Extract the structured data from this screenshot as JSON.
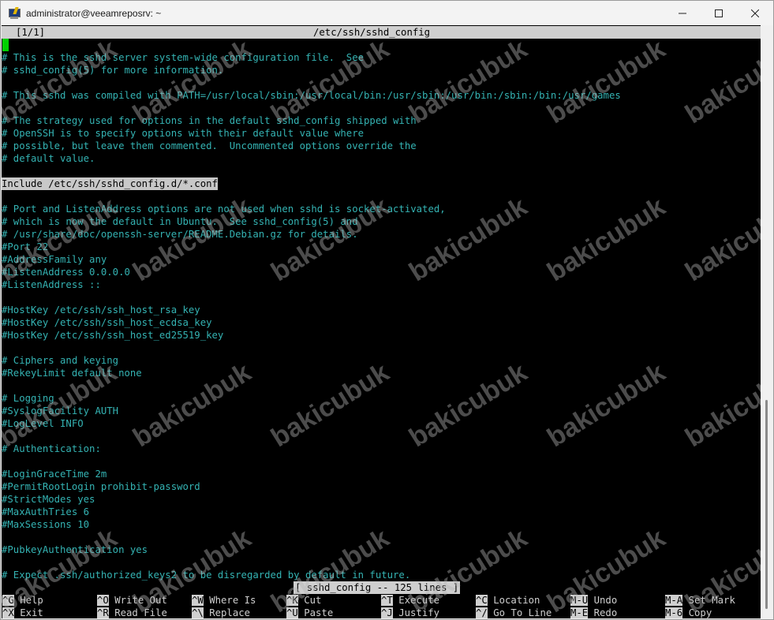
{
  "window": {
    "title": "administrator@veeamreposrv: ~",
    "icon": "putty-terminal-icon",
    "controls": [
      "minimize-icon",
      "maximize-icon",
      "close-icon"
    ]
  },
  "editor": {
    "position": "[1/1]",
    "filename": "/etc/ssh/sshd_config",
    "lines": [
      {
        "text": "# This is the sshd server system-wide configuration file.  See",
        "style": "comment"
      },
      {
        "text": "# sshd_config(5) for more information.",
        "style": "comment"
      },
      {
        "text": "",
        "style": "comment"
      },
      {
        "text": "# This sshd was compiled with PATH=/usr/local/sbin:/usr/local/bin:/usr/sbin:/usr/bin:/sbin:/bin:/usr/games",
        "style": "comment"
      },
      {
        "text": "",
        "style": "comment"
      },
      {
        "text": "# The strategy used for options in the default sshd_config shipped with",
        "style": "comment"
      },
      {
        "text": "# OpenSSH is to specify options with their default value where",
        "style": "comment"
      },
      {
        "text": "# possible, but leave them commented.  Uncommented options override the",
        "style": "comment"
      },
      {
        "text": "# default value.",
        "style": "comment"
      },
      {
        "text": "",
        "style": "comment"
      },
      {
        "text": "Include /etc/ssh/sshd_config.d/*.conf",
        "style": "hl"
      },
      {
        "text": "",
        "style": "comment"
      },
      {
        "text": "# Port and ListenAddress options are not used when sshd is socket-activated,",
        "style": "comment"
      },
      {
        "text": "# which is now the default in Ubuntu.  See sshd_config(5) and",
        "style": "comment"
      },
      {
        "text": "# /usr/share/doc/openssh-server/README.Debian.gz for details.",
        "style": "comment"
      },
      {
        "text": "#Port 22",
        "style": "comment"
      },
      {
        "text": "#AddressFamily any",
        "style": "comment"
      },
      {
        "text": "#ListenAddress 0.0.0.0",
        "style": "comment"
      },
      {
        "text": "#ListenAddress ::",
        "style": "comment"
      },
      {
        "text": "",
        "style": "comment"
      },
      {
        "text": "#HostKey /etc/ssh/ssh_host_rsa_key",
        "style": "comment"
      },
      {
        "text": "#HostKey /etc/ssh/ssh_host_ecdsa_key",
        "style": "comment"
      },
      {
        "text": "#HostKey /etc/ssh/ssh_host_ed25519_key",
        "style": "comment"
      },
      {
        "text": "",
        "style": "comment"
      },
      {
        "text": "# Ciphers and keying",
        "style": "comment"
      },
      {
        "text": "#RekeyLimit default none",
        "style": "comment"
      },
      {
        "text": "",
        "style": "comment"
      },
      {
        "text": "# Logging",
        "style": "comment"
      },
      {
        "text": "#SyslogFacility AUTH",
        "style": "comment"
      },
      {
        "text": "#LogLevel INFO",
        "style": "comment"
      },
      {
        "text": "",
        "style": "comment"
      },
      {
        "text": "# Authentication:",
        "style": "comment"
      },
      {
        "text": "",
        "style": "comment"
      },
      {
        "text": "#LoginGraceTime 2m",
        "style": "comment"
      },
      {
        "text": "#PermitRootLogin prohibit-password",
        "style": "comment"
      },
      {
        "text": "#StrictModes yes",
        "style": "comment"
      },
      {
        "text": "#MaxAuthTries 6",
        "style": "comment"
      },
      {
        "text": "#MaxSessions 10",
        "style": "comment"
      },
      {
        "text": "",
        "style": "comment"
      },
      {
        "text": "#PubkeyAuthentication yes",
        "style": "comment"
      },
      {
        "text": "",
        "style": "comment"
      },
      {
        "text": "# Expect .ssh/authorized_keys2 to be disregarded by default in future.",
        "style": "comment"
      }
    ],
    "status": "[ sshd_config -- 125 lines ]"
  },
  "shortcuts": [
    [
      {
        "key": "^G",
        "label": "Help"
      },
      {
        "key": "^O",
        "label": "Write Out"
      },
      {
        "key": "^W",
        "label": "Where Is"
      },
      {
        "key": "^K",
        "label": "Cut"
      },
      {
        "key": "^T",
        "label": "Execute"
      },
      {
        "key": "^C",
        "label": "Location"
      },
      {
        "key": "M-U",
        "label": "Undo"
      },
      {
        "key": "M-A",
        "label": "Set Mark"
      }
    ],
    [
      {
        "key": "^X",
        "label": "Exit"
      },
      {
        "key": "^R",
        "label": "Read File"
      },
      {
        "key": "^\\",
        "label": "Replace"
      },
      {
        "key": "^U",
        "label": "Paste"
      },
      {
        "key": "^J",
        "label": "Justify"
      },
      {
        "key": "^/",
        "label": "Go To Line"
      },
      {
        "key": "M-E",
        "label": "Redo"
      },
      {
        "key": "M-6",
        "label": "Copy"
      }
    ]
  ],
  "watermark": "bakicubuk",
  "colors": {
    "terminal_bg": "#000000",
    "comment": "#34b3b3",
    "highlight_bg": "#c8c8c8",
    "cursor": "#00d000"
  }
}
